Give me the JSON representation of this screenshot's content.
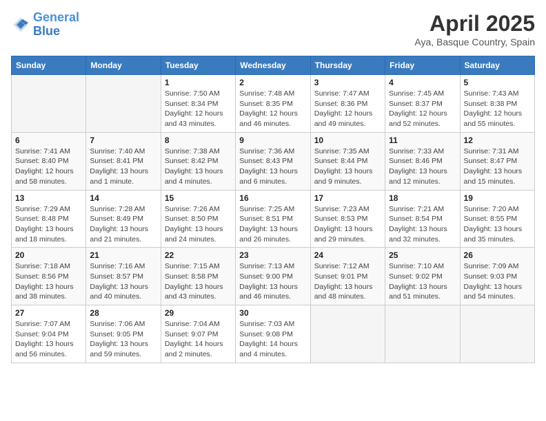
{
  "header": {
    "logo_general": "General",
    "logo_blue": "Blue",
    "month_title": "April 2025",
    "location": "Aya, Basque Country, Spain"
  },
  "calendar": {
    "weekdays": [
      "Sunday",
      "Monday",
      "Tuesday",
      "Wednesday",
      "Thursday",
      "Friday",
      "Saturday"
    ],
    "weeks": [
      [
        {
          "day": "",
          "sunrise": "",
          "sunset": "",
          "daylight": ""
        },
        {
          "day": "",
          "sunrise": "",
          "sunset": "",
          "daylight": ""
        },
        {
          "day": "1",
          "sunrise": "Sunrise: 7:50 AM",
          "sunset": "Sunset: 8:34 PM",
          "daylight": "Daylight: 12 hours and 43 minutes."
        },
        {
          "day": "2",
          "sunrise": "Sunrise: 7:48 AM",
          "sunset": "Sunset: 8:35 PM",
          "daylight": "Daylight: 12 hours and 46 minutes."
        },
        {
          "day": "3",
          "sunrise": "Sunrise: 7:47 AM",
          "sunset": "Sunset: 8:36 PM",
          "daylight": "Daylight: 12 hours and 49 minutes."
        },
        {
          "day": "4",
          "sunrise": "Sunrise: 7:45 AM",
          "sunset": "Sunset: 8:37 PM",
          "daylight": "Daylight: 12 hours and 52 minutes."
        },
        {
          "day": "5",
          "sunrise": "Sunrise: 7:43 AM",
          "sunset": "Sunset: 8:38 PM",
          "daylight": "Daylight: 12 hours and 55 minutes."
        }
      ],
      [
        {
          "day": "6",
          "sunrise": "Sunrise: 7:41 AM",
          "sunset": "Sunset: 8:40 PM",
          "daylight": "Daylight: 12 hours and 58 minutes."
        },
        {
          "day": "7",
          "sunrise": "Sunrise: 7:40 AM",
          "sunset": "Sunset: 8:41 PM",
          "daylight": "Daylight: 13 hours and 1 minute."
        },
        {
          "day": "8",
          "sunrise": "Sunrise: 7:38 AM",
          "sunset": "Sunset: 8:42 PM",
          "daylight": "Daylight: 13 hours and 4 minutes."
        },
        {
          "day": "9",
          "sunrise": "Sunrise: 7:36 AM",
          "sunset": "Sunset: 8:43 PM",
          "daylight": "Daylight: 13 hours and 6 minutes."
        },
        {
          "day": "10",
          "sunrise": "Sunrise: 7:35 AM",
          "sunset": "Sunset: 8:44 PM",
          "daylight": "Daylight: 13 hours and 9 minutes."
        },
        {
          "day": "11",
          "sunrise": "Sunrise: 7:33 AM",
          "sunset": "Sunset: 8:46 PM",
          "daylight": "Daylight: 13 hours and 12 minutes."
        },
        {
          "day": "12",
          "sunrise": "Sunrise: 7:31 AM",
          "sunset": "Sunset: 8:47 PM",
          "daylight": "Daylight: 13 hours and 15 minutes."
        }
      ],
      [
        {
          "day": "13",
          "sunrise": "Sunrise: 7:29 AM",
          "sunset": "Sunset: 8:48 PM",
          "daylight": "Daylight: 13 hours and 18 minutes."
        },
        {
          "day": "14",
          "sunrise": "Sunrise: 7:28 AM",
          "sunset": "Sunset: 8:49 PM",
          "daylight": "Daylight: 13 hours and 21 minutes."
        },
        {
          "day": "15",
          "sunrise": "Sunrise: 7:26 AM",
          "sunset": "Sunset: 8:50 PM",
          "daylight": "Daylight: 13 hours and 24 minutes."
        },
        {
          "day": "16",
          "sunrise": "Sunrise: 7:25 AM",
          "sunset": "Sunset: 8:51 PM",
          "daylight": "Daylight: 13 hours and 26 minutes."
        },
        {
          "day": "17",
          "sunrise": "Sunrise: 7:23 AM",
          "sunset": "Sunset: 8:53 PM",
          "daylight": "Daylight: 13 hours and 29 minutes."
        },
        {
          "day": "18",
          "sunrise": "Sunrise: 7:21 AM",
          "sunset": "Sunset: 8:54 PM",
          "daylight": "Daylight: 13 hours and 32 minutes."
        },
        {
          "day": "19",
          "sunrise": "Sunrise: 7:20 AM",
          "sunset": "Sunset: 8:55 PM",
          "daylight": "Daylight: 13 hours and 35 minutes."
        }
      ],
      [
        {
          "day": "20",
          "sunrise": "Sunrise: 7:18 AM",
          "sunset": "Sunset: 8:56 PM",
          "daylight": "Daylight: 13 hours and 38 minutes."
        },
        {
          "day": "21",
          "sunrise": "Sunrise: 7:16 AM",
          "sunset": "Sunset: 8:57 PM",
          "daylight": "Daylight: 13 hours and 40 minutes."
        },
        {
          "day": "22",
          "sunrise": "Sunrise: 7:15 AM",
          "sunset": "Sunset: 8:58 PM",
          "daylight": "Daylight: 13 hours and 43 minutes."
        },
        {
          "day": "23",
          "sunrise": "Sunrise: 7:13 AM",
          "sunset": "Sunset: 9:00 PM",
          "daylight": "Daylight: 13 hours and 46 minutes."
        },
        {
          "day": "24",
          "sunrise": "Sunrise: 7:12 AM",
          "sunset": "Sunset: 9:01 PM",
          "daylight": "Daylight: 13 hours and 48 minutes."
        },
        {
          "day": "25",
          "sunrise": "Sunrise: 7:10 AM",
          "sunset": "Sunset: 9:02 PM",
          "daylight": "Daylight: 13 hours and 51 minutes."
        },
        {
          "day": "26",
          "sunrise": "Sunrise: 7:09 AM",
          "sunset": "Sunset: 9:03 PM",
          "daylight": "Daylight: 13 hours and 54 minutes."
        }
      ],
      [
        {
          "day": "27",
          "sunrise": "Sunrise: 7:07 AM",
          "sunset": "Sunset: 9:04 PM",
          "daylight": "Daylight: 13 hours and 56 minutes."
        },
        {
          "day": "28",
          "sunrise": "Sunrise: 7:06 AM",
          "sunset": "Sunset: 9:05 PM",
          "daylight": "Daylight: 13 hours and 59 minutes."
        },
        {
          "day": "29",
          "sunrise": "Sunrise: 7:04 AM",
          "sunset": "Sunset: 9:07 PM",
          "daylight": "Daylight: 14 hours and 2 minutes."
        },
        {
          "day": "30",
          "sunrise": "Sunrise: 7:03 AM",
          "sunset": "Sunset: 9:08 PM",
          "daylight": "Daylight: 14 hours and 4 minutes."
        },
        {
          "day": "",
          "sunrise": "",
          "sunset": "",
          "daylight": ""
        },
        {
          "day": "",
          "sunrise": "",
          "sunset": "",
          "daylight": ""
        },
        {
          "day": "",
          "sunrise": "",
          "sunset": "",
          "daylight": ""
        }
      ]
    ]
  }
}
